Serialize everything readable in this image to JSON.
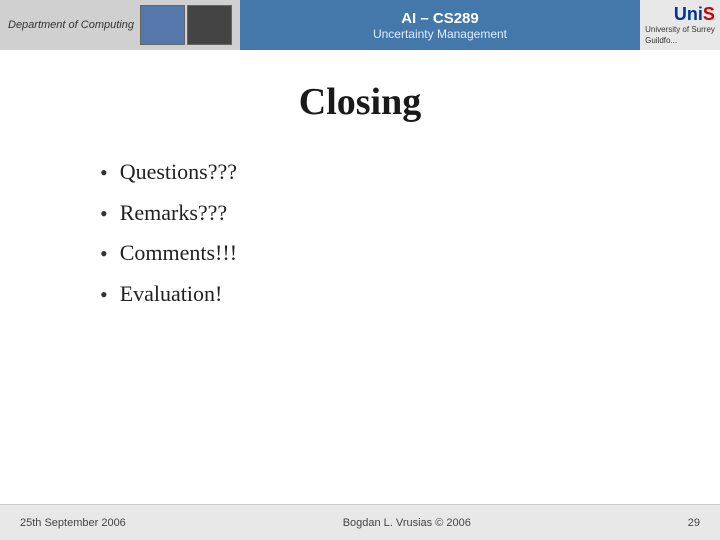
{
  "header": {
    "dept_label": "Department of Computing",
    "title": "AI – CS289",
    "subtitle": "Uncertainty Management",
    "uni_initial": "UniS",
    "uni_name": "University of Surrey",
    "uni_sub": "Guildfo..."
  },
  "slide": {
    "title": "Closing",
    "bullets": [
      "Questions???",
      "Remarks???",
      "Comments!!!",
      "Evaluation!"
    ]
  },
  "footer": {
    "date": "25th September 2006",
    "author": "Bogdan L. Vrusias © 2006",
    "page": "29"
  }
}
